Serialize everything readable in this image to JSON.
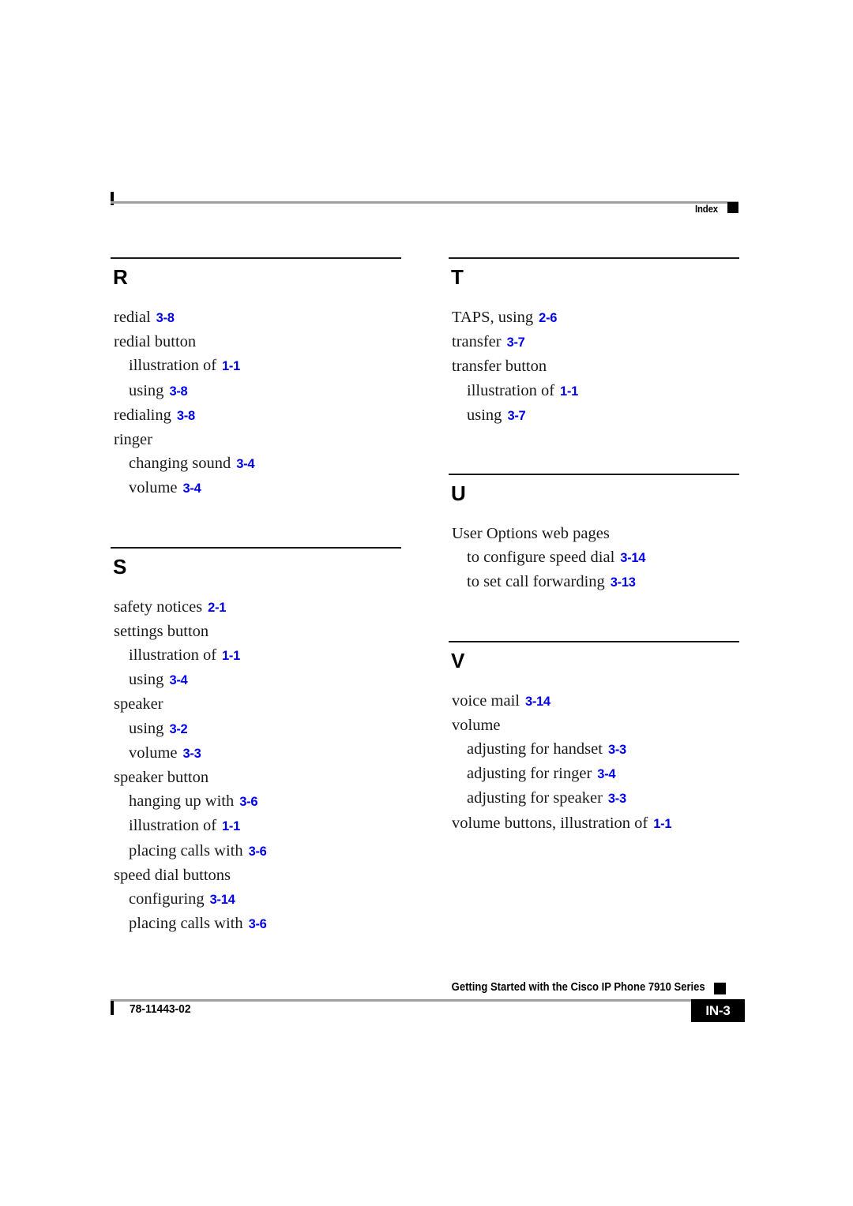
{
  "header": {
    "label": "Index"
  },
  "footer": {
    "title": "Getting Started with the Cisco IP Phone 7910 Series",
    "doc_number": "78-11443-02",
    "page_badge": "IN-3"
  },
  "columns": [
    {
      "name": "left",
      "sections": [
        {
          "letter": "R",
          "entries": [
            {
              "level": 0,
              "text": "redial",
              "page": "3-8"
            },
            {
              "level": 0,
              "text": "redial button",
              "page": ""
            },
            {
              "level": 1,
              "text": "illustration of",
              "page": "1-1"
            },
            {
              "level": 1,
              "text": "using",
              "page": "3-8"
            },
            {
              "level": 0,
              "text": "redialing",
              "page": "3-8"
            },
            {
              "level": 0,
              "text": "ringer",
              "page": ""
            },
            {
              "level": 1,
              "text": "changing sound",
              "page": "3-4"
            },
            {
              "level": 1,
              "text": "volume",
              "page": "3-4"
            }
          ]
        },
        {
          "letter": "S",
          "entries": [
            {
              "level": 0,
              "text": "safety notices",
              "page": "2-1"
            },
            {
              "level": 0,
              "text": "settings button",
              "page": ""
            },
            {
              "level": 1,
              "text": "illustration of",
              "page": "1-1"
            },
            {
              "level": 1,
              "text": "using",
              "page": "3-4"
            },
            {
              "level": 0,
              "text": "speaker",
              "page": ""
            },
            {
              "level": 1,
              "text": "using",
              "page": "3-2"
            },
            {
              "level": 1,
              "text": "volume",
              "page": "3-3"
            },
            {
              "level": 0,
              "text": "speaker button",
              "page": ""
            },
            {
              "level": 1,
              "text": "hanging up with",
              "page": "3-6"
            },
            {
              "level": 1,
              "text": "illustration of",
              "page": "1-1"
            },
            {
              "level": 1,
              "text": "placing calls with",
              "page": "3-6"
            },
            {
              "level": 0,
              "text": "speed dial buttons",
              "page": ""
            },
            {
              "level": 1,
              "text": "configuring",
              "page": "3-14"
            },
            {
              "level": 1,
              "text": "placing calls with",
              "page": "3-6"
            }
          ]
        }
      ]
    },
    {
      "name": "right",
      "sections": [
        {
          "letter": "T",
          "entries": [
            {
              "level": 0,
              "text": "TAPS, using",
              "page": "2-6"
            },
            {
              "level": 0,
              "text": "transfer",
              "page": "3-7"
            },
            {
              "level": 0,
              "text": "transfer button",
              "page": ""
            },
            {
              "level": 1,
              "text": "illustration of",
              "page": "1-1"
            },
            {
              "level": 1,
              "text": "using",
              "page": "3-7"
            }
          ]
        },
        {
          "letter": "U",
          "entries": [
            {
              "level": 0,
              "text": "User Options web pages",
              "page": ""
            },
            {
              "level": 1,
              "text": "to configure speed dial",
              "page": "3-14"
            },
            {
              "level": 1,
              "text": "to set call forwarding",
              "page": "3-13"
            }
          ]
        },
        {
          "letter": "V",
          "entries": [
            {
              "level": 0,
              "text": "voice mail",
              "page": "3-14"
            },
            {
              "level": 0,
              "text": "volume",
              "page": ""
            },
            {
              "level": 1,
              "text": "adjusting for handset",
              "page": "3-3"
            },
            {
              "level": 1,
              "text": "adjusting for ringer",
              "page": "3-4"
            },
            {
              "level": 1,
              "text": "adjusting for speaker",
              "page": "3-3"
            },
            {
              "level": 0,
              "text": "volume buttons, illustration of",
              "page": "1-1"
            }
          ]
        }
      ]
    }
  ],
  "colors": {
    "page_ref": "#0000ee",
    "rule_gray": "#a0a0a0",
    "rule_black": "#1a1a1a"
  }
}
